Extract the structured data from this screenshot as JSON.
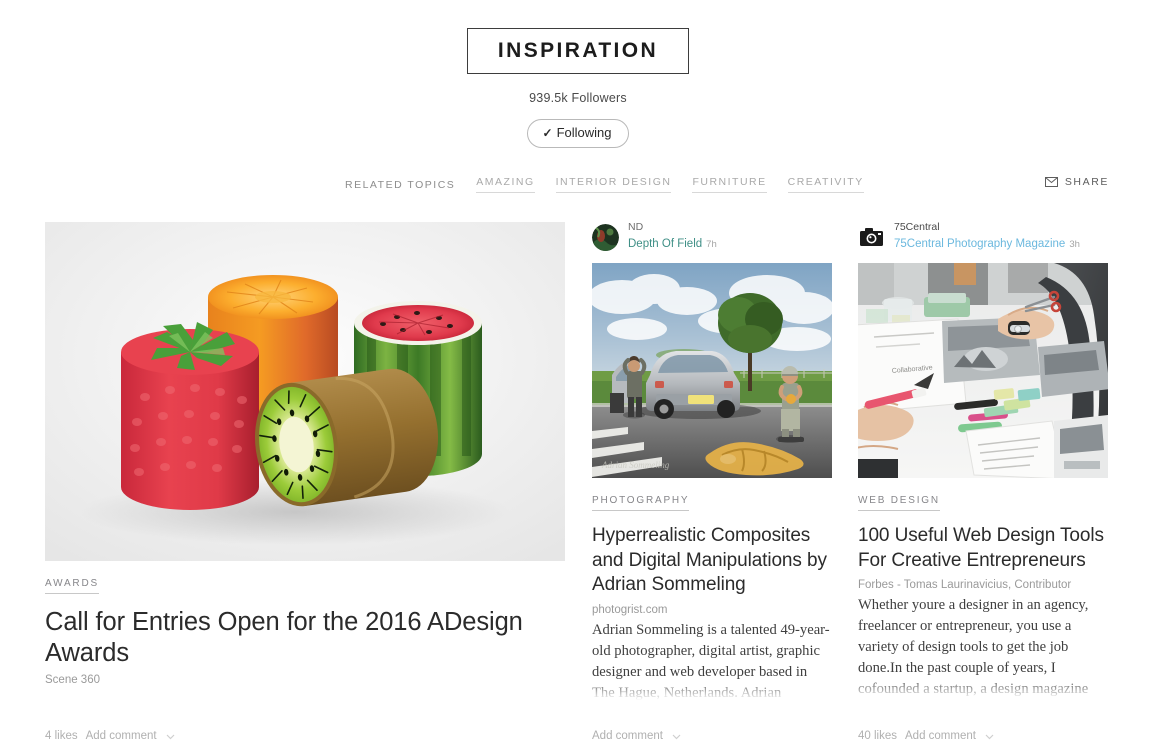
{
  "header": {
    "topic_title": "INSPIRATION",
    "followers": "939.5k Followers",
    "following_label": "Following",
    "following_check": "✓"
  },
  "topics_bar": {
    "label": "RELATED TOPICS",
    "chips": [
      "AMAZING",
      "INTERIOR DESIGN",
      "FURNITURE",
      "CREATIVITY"
    ],
    "share_label": "SHARE"
  },
  "colors": {
    "publication_teal": "#3f8f86",
    "publication_blue": "#6bb8de",
    "border_dark": "#3d3d3d",
    "muted_text": "#a9a9a9"
  },
  "cards": [
    {
      "id": "card-awards",
      "category": "AWARDS",
      "title": "Call for Entries Open for the 2016 ADesign Awards",
      "source": "Scene 360",
      "body": "",
      "image_alt": "fruit-textured cylindrical stools: strawberry, orange, watermelon, kiwi",
      "footer": {
        "likes": "4 likes",
        "add_comment": "Add comment"
      }
    },
    {
      "id": "card-photography",
      "author": {
        "name": "ND",
        "publication": "Depth Of Field",
        "time": "7h",
        "avatar": "photo-avatar"
      },
      "category": "PHOTOGRAPHY",
      "title": "Hyperrealistic Composites and Digital Manipulations by Adrian Sommeling",
      "source": "photogrist.com",
      "body": "Adrian Sommeling is a talented 49-year-old photographer, digital artist, graphic designer and web developer based in The Hague, Netherlands. Adrian",
      "image_alt": "composite photo of silver car on road with man and boy",
      "footer": {
        "likes": "",
        "add_comment": "Add comment"
      }
    },
    {
      "id": "card-webdesign",
      "author": {
        "name": "75Central",
        "publication": "75Central Photography Magazine",
        "time": "3h",
        "avatar": "camera-avatar"
      },
      "category": "WEB DESIGN",
      "title": "100 Useful Web Design Tools For Creative Entrepreneurs",
      "source": "Forbes - Tomas Laurinavicius, Contributor",
      "body": "Whether youre a designer in an agency, freelancer or entrepreneur, you use a variety of design tools to get the job done.In the past couple of years, I cofounded a startup, a design magazine and worked with several businesses and individual entrepreneurs. I have tried hundreds of different tools",
      "image_alt": "hands working at desk with papers, markers and magazines",
      "footer": {
        "likes": "40 likes",
        "add_comment": "Add comment"
      }
    }
  ]
}
